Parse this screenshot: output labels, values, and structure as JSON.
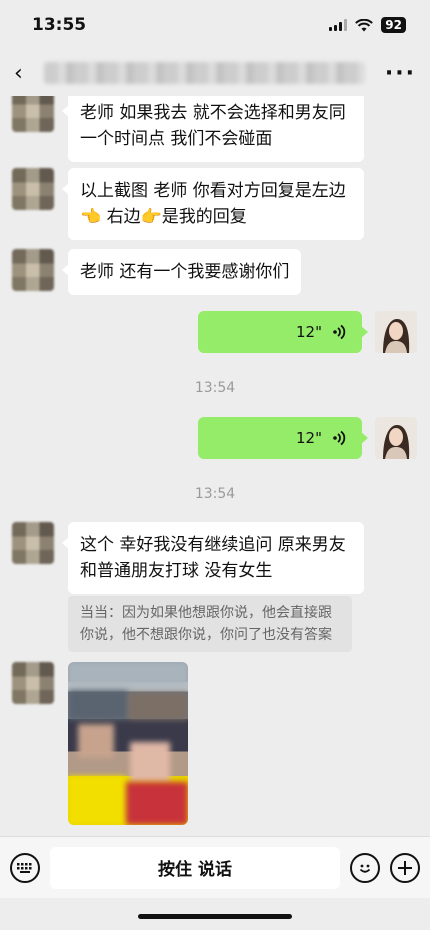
{
  "status": {
    "time": "13:55",
    "battery": "92"
  },
  "nav": {
    "back_glyph": "‹",
    "more_glyph": "···"
  },
  "messages": {
    "m1": "老师 如果我去 就不会选择和男友同一个时间点 我们不会碰面",
    "m2": "以上截图 老师 你看对方回复是左边👈 右边👉是我的回复",
    "m3": "老师 还有一个我要感谢你们",
    "voice1": "12\"",
    "time1": "13:54",
    "voice2": "12\"",
    "time2": "13:54",
    "m4": "这个 幸好我没有继续追问 原来男友和普通朋友打球 没有女生",
    "quote": "当当：因为如果他想跟你说，他会直接跟你说，他不想跟你说，你问了也没有答案"
  },
  "input": {
    "hold_to_talk": "按住 说话"
  },
  "icons": {
    "back": "chevron-left-icon",
    "more": "more-dots-icon",
    "voice": "voice-wave-icon",
    "keyboard": "keyboard-icon",
    "emoji": "emoji-icon",
    "add": "plus-icon"
  }
}
